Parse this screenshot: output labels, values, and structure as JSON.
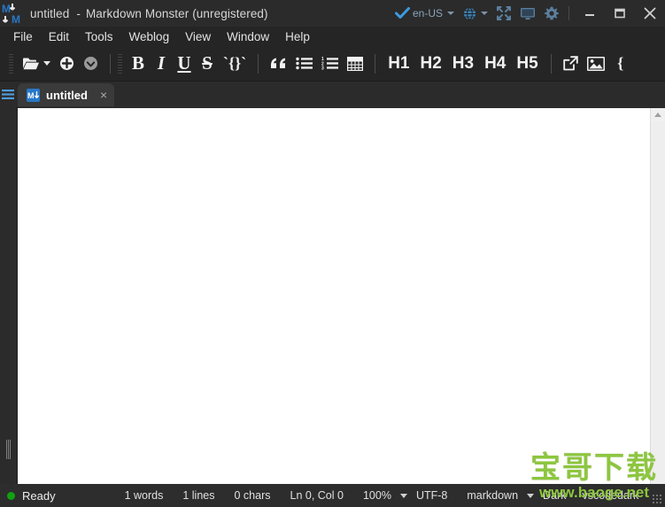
{
  "window": {
    "title_document": "untitled",
    "title_separator": "-",
    "title_app": "Markdown Monster (unregistered)",
    "logo_icon": "markdown-monster-logo-icon"
  },
  "titlebar_right": {
    "spellcheck_icon": "check-icon",
    "language": "en-US",
    "language_caret_icon": "chevron-down-icon",
    "globe_icon": "globe-icon",
    "globe_caret_icon": "chevron-down-icon",
    "distraction_free_icon": "expand-arrows-icon",
    "presentation_icon": "monitor-icon",
    "settings_icon": "gear-icon",
    "minimize_icon": "minimize-icon",
    "maximize_icon": "maximize-icon",
    "close_icon": "close-icon"
  },
  "menu": {
    "items": [
      {
        "label": "File"
      },
      {
        "label": "Edit"
      },
      {
        "label": "Tools"
      },
      {
        "label": "Weblog"
      },
      {
        "label": "View"
      },
      {
        "label": "Window"
      },
      {
        "label": "Help"
      }
    ]
  },
  "toolbar": {
    "open_icon": "folder-open-icon",
    "open_caret_icon": "chevron-down-icon",
    "save_icon": "save-icon",
    "saveas_icon": "save-as-icon",
    "bold_label": "B",
    "italic_label": "I",
    "underline_label": "U",
    "strikethrough_label": "S",
    "code_label": "`{}`",
    "quote_label": "“",
    "bullet_list_icon": "bullet-list-icon",
    "numbered_list_icon": "numbered-list-icon",
    "table_icon": "table-icon",
    "headings": [
      "H1",
      "H2",
      "H3",
      "H4",
      "H5"
    ],
    "link_icon": "external-link-icon",
    "image_icon": "image-icon",
    "overflow_label": "{"
  },
  "tabbar": {
    "menu_icon": "hamburger-menu-icon",
    "tabs": [
      {
        "icon": "markdown-icon",
        "label": "untitled",
        "close_label": "×",
        "active": true
      }
    ]
  },
  "editor": {
    "content": "",
    "scrollbar_up_icon": "scroll-up-arrow-icon"
  },
  "statusbar": {
    "status_icon": "status-dot-icon",
    "status_text": "Ready",
    "words": "1 words",
    "lines": "1 lines",
    "chars": "0 chars",
    "cursor": "Ln 0, Col 0",
    "zoom": "100%",
    "zoom_caret_icon": "chevron-down-icon",
    "encoding": "UTF-8",
    "syntax": "markdown",
    "syntax_caret_icon": "chevron-down-icon",
    "theme": "Dark",
    "editor_theme": "vscodedark",
    "resize_grip_icon": "resize-grip-icon"
  },
  "watermark": {
    "brand": "宝哥下载",
    "url": "www.baoge.net",
    "color": "#8dc63f"
  }
}
